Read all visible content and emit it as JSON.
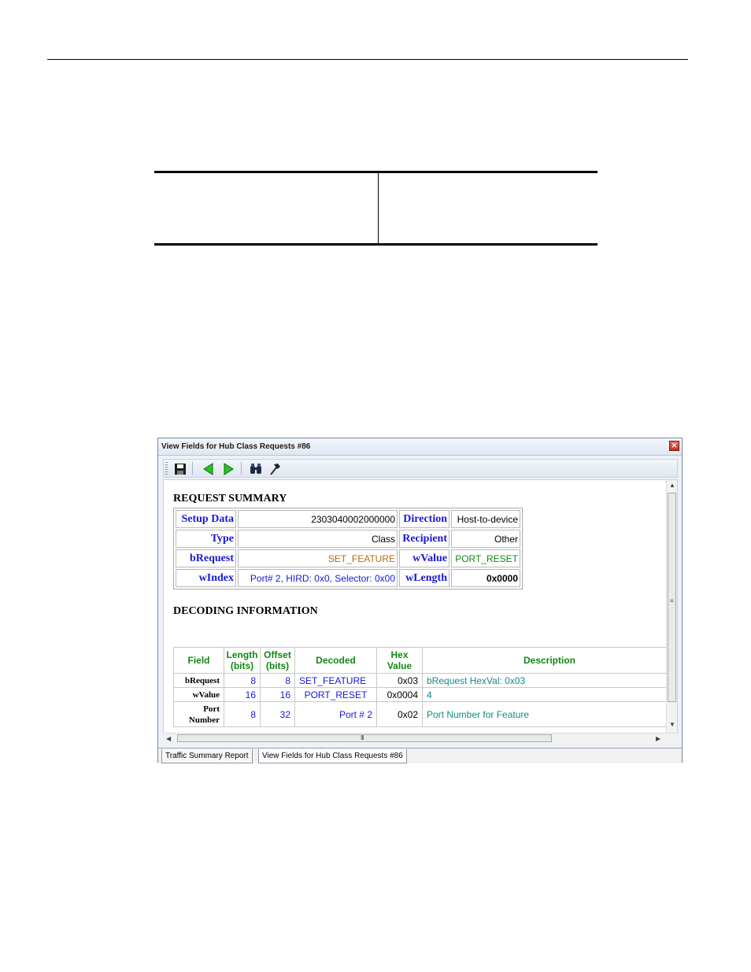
{
  "window": {
    "title": "View Fields for Hub Class Requests #86",
    "close_glyph": "✕"
  },
  "toolbar": {
    "buttons": [
      {
        "icon": "save-icon"
      },
      {
        "icon": "arrow-left-icon"
      },
      {
        "icon": "arrow-right-icon"
      },
      {
        "icon": "binoculars-icon"
      },
      {
        "icon": "hammer-icon"
      }
    ]
  },
  "request_summary": {
    "title": "REQUEST SUMMARY",
    "rows": [
      {
        "label1": "Setup Data",
        "value1": "2303040002000000",
        "label2": "Direction",
        "value2": "Host-to-device"
      },
      {
        "label1": "Type",
        "value1": "Class",
        "label2": "Recipient",
        "value2": "Other"
      },
      {
        "label1": "bRequest",
        "value1": "SET_FEATURE",
        "label2": "wValue",
        "value2": "PORT_RESET"
      },
      {
        "label1": "wIndex",
        "value1": "Port# 2, HIRD: 0x0,  Selector: 0x00",
        "label2": "wLength",
        "value2": "0x0000"
      }
    ]
  },
  "decoding": {
    "title": "DECODING INFORMATION",
    "headers": {
      "field": "Field",
      "length_1": "Length",
      "length_2": "(bits)",
      "offset_1": "Offset",
      "offset_2": "(bits)",
      "decoded": "Decoded",
      "hex_1": "Hex",
      "hex_2": "Value",
      "description": "Description"
    },
    "rows": [
      {
        "field_1": "bRequest",
        "field_2": "",
        "length": "8",
        "offset": "8",
        "decoded": "SET_FEATURE",
        "hex": "0x03",
        "description": "bRequest HexVal: 0x03"
      },
      {
        "field_1": "wValue",
        "field_2": "",
        "length": "16",
        "offset": "16",
        "decoded": "PORT_RESET",
        "hex": "0x0004",
        "description": "4"
      },
      {
        "field_1": "Port",
        "field_2": "Number",
        "length": "8",
        "offset": "32",
        "decoded": "Port # 2",
        "hex": "0x02",
        "description": "Port Number for Feature"
      }
    ]
  },
  "scrollbars": {
    "v_grip": "≡",
    "h_grip": "III",
    "up": "▲",
    "down": "▼",
    "left": "◀",
    "right": "▶"
  },
  "tabs": [
    {
      "label": "Traffic Summary Report"
    },
    {
      "label": "View Fields for Hub Class Requests #86"
    }
  ],
  "colors": {
    "label_blue": "#1818d8",
    "header_green": "#118811",
    "set_feature_brown": "#b46b12",
    "desc_teal": "#138a8a"
  }
}
